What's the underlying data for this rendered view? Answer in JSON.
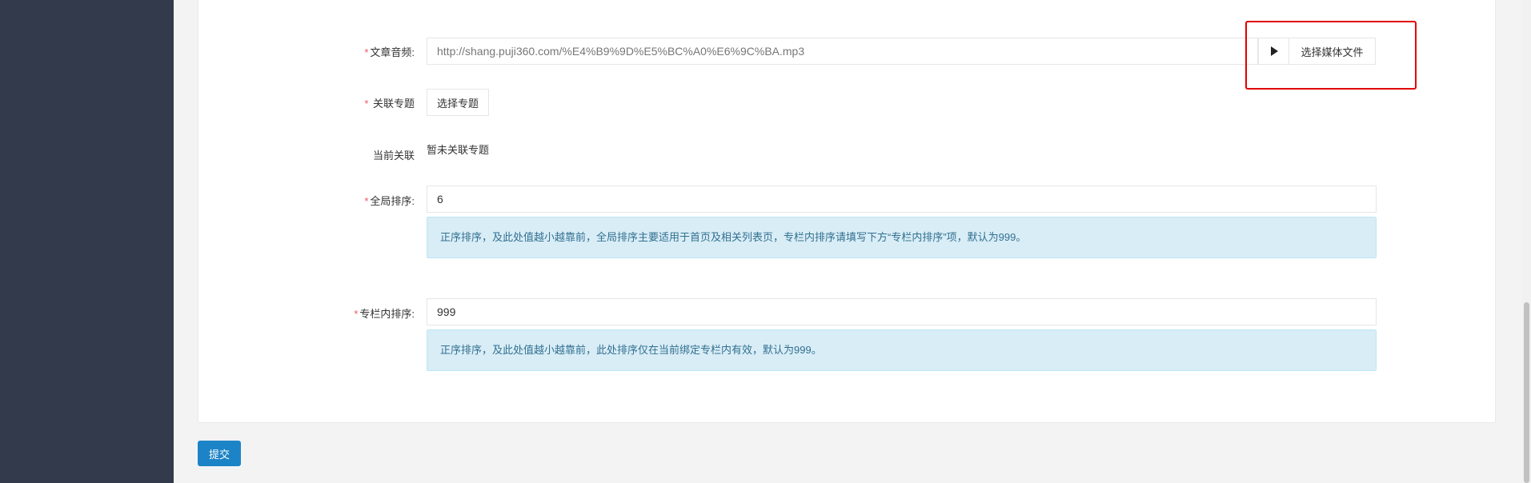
{
  "form": {
    "required_mark": "*",
    "audio": {
      "label": "文章音频:",
      "value": "http://shang.puji360.com/%E4%B9%9D%E5%BC%A0%E6%9C%BA.mp3",
      "play_icon": "play-icon",
      "select_media_label": "选择媒体文件"
    },
    "topic": {
      "label": " 关联专题",
      "select_label": "选择专题"
    },
    "current": {
      "label": "当前关联",
      "value": "暂未关联专题"
    },
    "global_sort": {
      "label": "全局排序:",
      "value": "6",
      "hint": "正序排序，及此处值越小越靠前，全局排序主要适用于首页及相关列表页，专栏内排序请填写下方“专栏内排序”项，默认为999。"
    },
    "column_sort": {
      "label": "专栏内排序:",
      "value": "999",
      "hint": "正序排序，及此处值越小越靠前，此处排序仅在当前绑定专栏内有效，默认为999。"
    },
    "submit_label": "提交"
  },
  "colors": {
    "sidebar": "#323a4b",
    "required": "#ed5565",
    "primary": "#1c84c6",
    "hint_bg": "#d9edf7",
    "hint_text": "#31708f",
    "highlight": "#e10000"
  }
}
